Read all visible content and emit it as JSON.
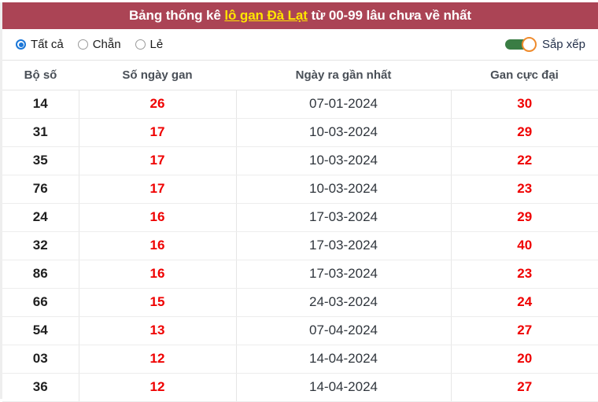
{
  "header": {
    "title_prefix": "Bảng thống kê ",
    "title_highlight": "lô gan Đà Lạt",
    "title_suffix": " từ 00-99 lâu chưa về nhất",
    "bar_color": "#ab4455",
    "highlight_color": "#ffe600"
  },
  "filters": {
    "radios": [
      {
        "label": "Tất cả",
        "selected": true
      },
      {
        "label": "Chẵn",
        "selected": false
      },
      {
        "label": "Lẻ",
        "selected": false
      }
    ],
    "sort_toggle": {
      "label": "Sắp xếp",
      "on": true,
      "track_color": "#3a7d44",
      "knob_border_color": "#ef8b2c"
    }
  },
  "table": {
    "columns": [
      "Bộ số",
      "Số ngày gan",
      "Ngày ra gần nhất",
      "Gan cực đại"
    ],
    "rows": [
      {
        "bo_so": "14",
        "so_ngay_gan": "26",
        "ngay_ra_gan_nhat": "07-01-2024",
        "gan_cuc_dai": "30"
      },
      {
        "bo_so": "31",
        "so_ngay_gan": "17",
        "ngay_ra_gan_nhat": "10-03-2024",
        "gan_cuc_dai": "29"
      },
      {
        "bo_so": "35",
        "so_ngay_gan": "17",
        "ngay_ra_gan_nhat": "10-03-2024",
        "gan_cuc_dai": "22"
      },
      {
        "bo_so": "76",
        "so_ngay_gan": "17",
        "ngay_ra_gan_nhat": "10-03-2024",
        "gan_cuc_dai": "23"
      },
      {
        "bo_so": "24",
        "so_ngay_gan": "16",
        "ngay_ra_gan_nhat": "17-03-2024",
        "gan_cuc_dai": "29"
      },
      {
        "bo_so": "32",
        "so_ngay_gan": "16",
        "ngay_ra_gan_nhat": "17-03-2024",
        "gan_cuc_dai": "40"
      },
      {
        "bo_so": "86",
        "so_ngay_gan": "16",
        "ngay_ra_gan_nhat": "17-03-2024",
        "gan_cuc_dai": "23"
      },
      {
        "bo_so": "66",
        "so_ngay_gan": "15",
        "ngay_ra_gan_nhat": "24-03-2024",
        "gan_cuc_dai": "24"
      },
      {
        "bo_so": "54",
        "so_ngay_gan": "13",
        "ngay_ra_gan_nhat": "07-04-2024",
        "gan_cuc_dai": "27"
      },
      {
        "bo_so": "03",
        "so_ngay_gan": "12",
        "ngay_ra_gan_nhat": "14-04-2024",
        "gan_cuc_dai": "20"
      },
      {
        "bo_so": "36",
        "so_ngay_gan": "12",
        "ngay_ra_gan_nhat": "14-04-2024",
        "gan_cuc_dai": "27"
      }
    ]
  }
}
